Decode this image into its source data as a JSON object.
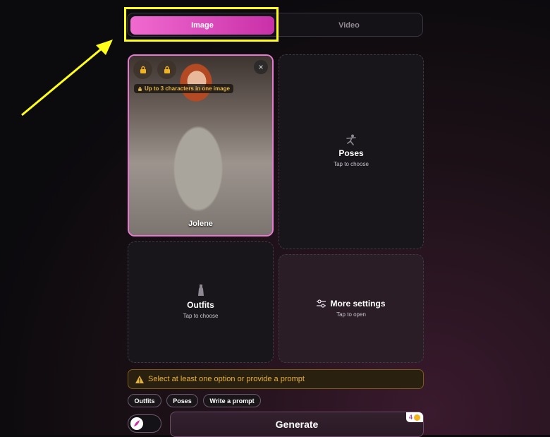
{
  "tabs": [
    {
      "label": "Image",
      "active": true
    },
    {
      "label": "Video",
      "active": false
    }
  ],
  "character": {
    "name": "Jolene",
    "limit_badge": "Up to 3 characters in one image",
    "close_glyph": "×"
  },
  "cards": {
    "poses": {
      "title": "Poses",
      "subtitle": "Tap to choose",
      "icon": "pose-icon"
    },
    "outfits": {
      "title": "Outfits",
      "subtitle": "Tap to choose",
      "icon": "dress-icon"
    },
    "more_settings": {
      "title": "More settings",
      "subtitle": "Tap to open",
      "icon": "sliders-icon"
    }
  },
  "warning": {
    "text": "Select at least one option or provide a prompt",
    "icon": "warning-icon"
  },
  "chips": [
    "Outfits",
    "Poses",
    "Write a prompt"
  ],
  "generate": {
    "label": "Generate",
    "credits": "4"
  },
  "colors": {
    "accent": "#e05cc8",
    "highlight": "#ffff1a",
    "warning": "#e5b23a"
  }
}
